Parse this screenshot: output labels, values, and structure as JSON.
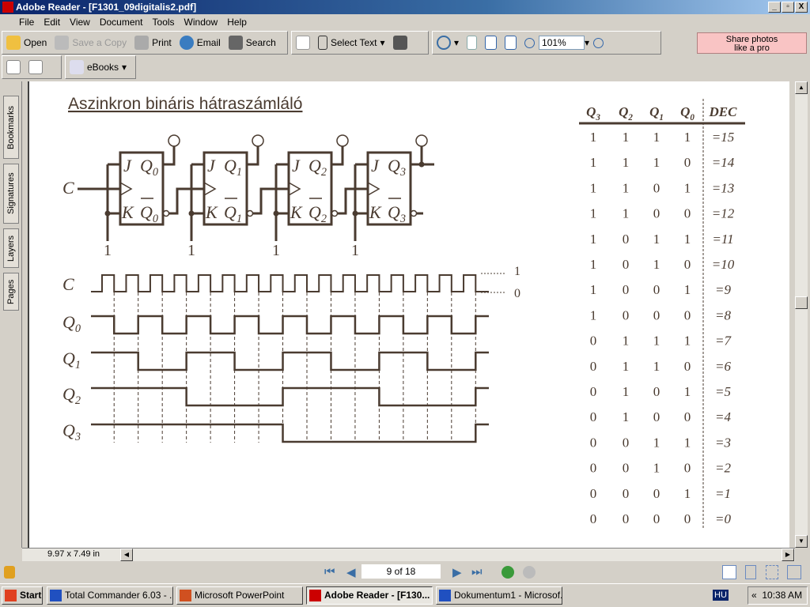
{
  "window": {
    "title": "Adobe Reader - [F1301_09digitalis2.pdf]"
  },
  "menu": [
    "File",
    "Edit",
    "View",
    "Document",
    "Tools",
    "Window",
    "Help"
  ],
  "toolbar": {
    "open": "Open",
    "save_copy": "Save a Copy",
    "print": "Print",
    "email": "Email",
    "search": "Search",
    "select_text": "Select Text",
    "zoom": "101%",
    "ebooks": "eBooks",
    "share": "Share photos like a pro"
  },
  "sidebar_tabs": [
    "Bookmarks",
    "Signatures",
    "Layers",
    "Pages"
  ],
  "document": {
    "title": "Aszinkron bináris hátraszámláló",
    "circuit": {
      "clock_label": "C",
      "flipflops": [
        {
          "j": "J",
          "k": "K",
          "q": "Q",
          "index": "0",
          "input": "1"
        },
        {
          "j": "J",
          "k": "K",
          "q": "Q",
          "index": "1",
          "input": "1"
        },
        {
          "j": "J",
          "k": "K",
          "q": "Q",
          "index": "2",
          "input": "1"
        },
        {
          "j": "J",
          "k": "K",
          "q": "Q",
          "index": "3",
          "input": "1"
        }
      ]
    },
    "timing": {
      "clock": {
        "label": "C",
        "pulses": 16,
        "high_label": "1",
        "low_label": "0"
      },
      "signals": [
        {
          "label": "Q",
          "index": "0",
          "toggle_every": 1
        },
        {
          "label": "Q",
          "index": "1",
          "toggle_every": 2
        },
        {
          "label": "Q",
          "index": "2",
          "toggle_every": 4
        },
        {
          "label": "Q",
          "index": "3",
          "toggle_every": 8
        }
      ]
    },
    "table": {
      "headers": [
        {
          "t": "Q",
          "s": "3"
        },
        {
          "t": "Q",
          "s": "2"
        },
        {
          "t": "Q",
          "s": "1"
        },
        {
          "t": "Q",
          "s": "0"
        },
        {
          "t": "DEC",
          "s": ""
        }
      ],
      "rows": [
        [
          "1",
          "1",
          "1",
          "1",
          "=15"
        ],
        [
          "1",
          "1",
          "1",
          "0",
          "=14"
        ],
        [
          "1",
          "1",
          "0",
          "1",
          "=13"
        ],
        [
          "1",
          "1",
          "0",
          "0",
          "=12"
        ],
        [
          "1",
          "0",
          "1",
          "1",
          "=11"
        ],
        [
          "1",
          "0",
          "1",
          "0",
          "=10"
        ],
        [
          "1",
          "0",
          "0",
          "1",
          "=9"
        ],
        [
          "1",
          "0",
          "0",
          "0",
          "=8"
        ],
        [
          "0",
          "1",
          "1",
          "1",
          "=7"
        ],
        [
          "0",
          "1",
          "1",
          "0",
          "=6"
        ],
        [
          "0",
          "1",
          "0",
          "1",
          "=5"
        ],
        [
          "0",
          "1",
          "0",
          "0",
          "=4"
        ],
        [
          "0",
          "0",
          "1",
          "1",
          "=3"
        ],
        [
          "0",
          "0",
          "1",
          "0",
          "=2"
        ],
        [
          "0",
          "0",
          "0",
          "1",
          "=1"
        ],
        [
          "0",
          "0",
          "0",
          "0",
          "=0"
        ]
      ]
    }
  },
  "status": {
    "page_size": "9.97 x 7.49 in",
    "page": "9 of 18"
  },
  "taskbar": {
    "start": "Start",
    "tasks": [
      "Total Commander 6.03 - ...",
      "Microsoft PowerPoint",
      "Adobe Reader - [F130...",
      "Dokumentum1 - Microsof..."
    ],
    "lang": "HU",
    "clock": "10:38 AM"
  },
  "colors": {
    "ink": "#4a3b30",
    "title_blue": "#0a246a"
  }
}
